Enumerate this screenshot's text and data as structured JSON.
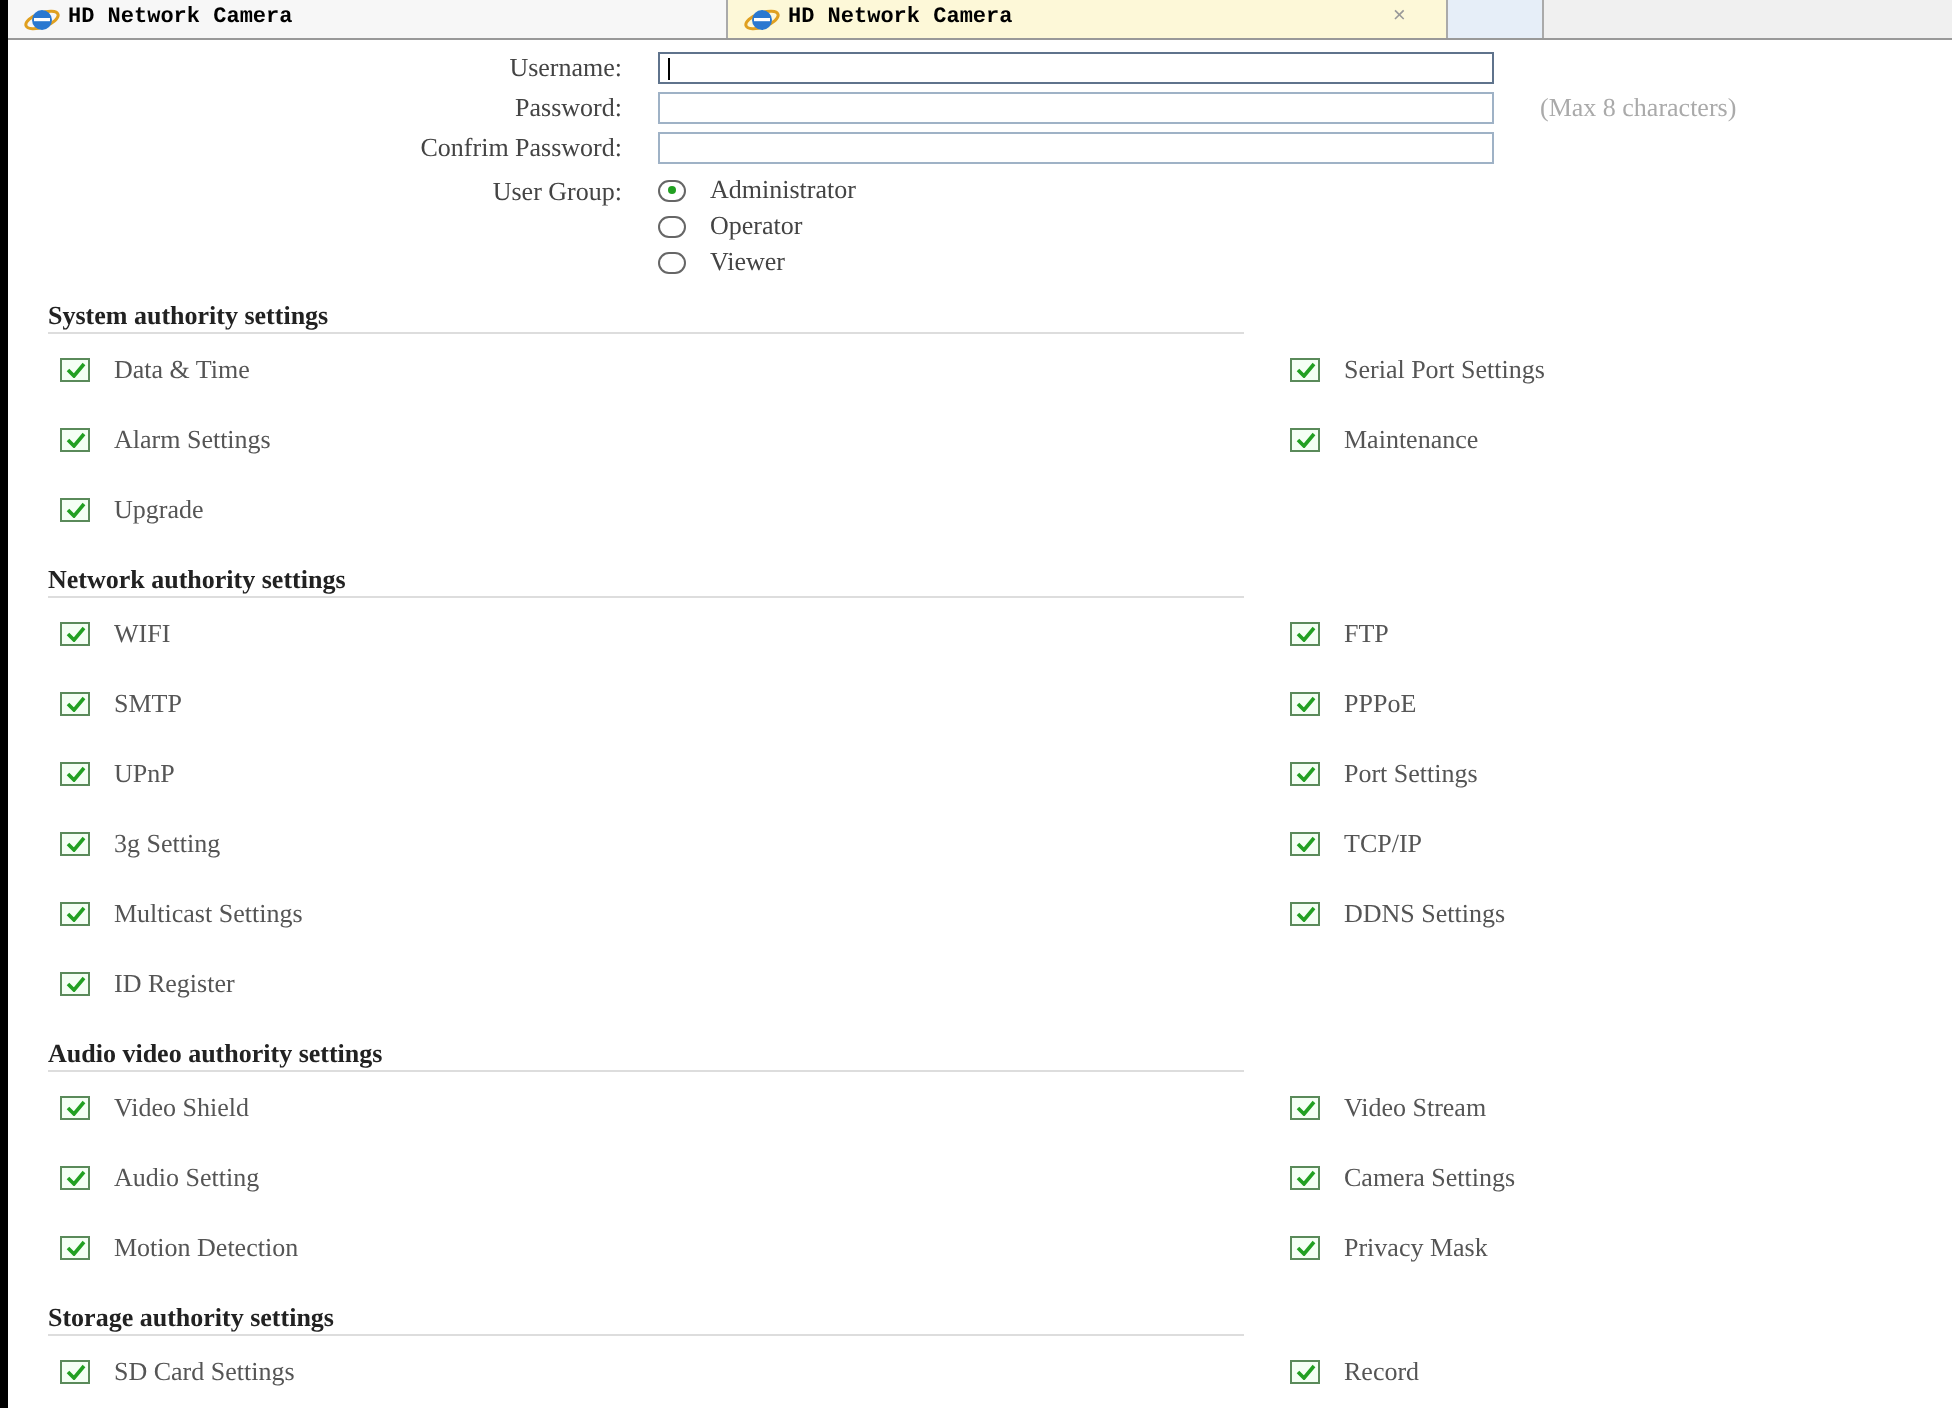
{
  "tabs": [
    {
      "label": "HD Network Camera",
      "selected": false
    },
    {
      "label": "HD Network Camera",
      "selected": true,
      "close": "×"
    }
  ],
  "form": {
    "fields": [
      {
        "label": "Username:",
        "focused": true
      },
      {
        "label": "Password:",
        "focused": false,
        "hint": "(Max 8 characters)"
      },
      {
        "label": "Confrim Password:",
        "focused": false
      }
    ],
    "user_group": {
      "label": "User Group:",
      "options": [
        {
          "label": "Administrator",
          "selected": true
        },
        {
          "label": "Operator",
          "selected": false
        },
        {
          "label": "Viewer",
          "selected": false
        }
      ]
    }
  },
  "sections": [
    {
      "title": "System authority settings",
      "items": [
        {
          "label": "Data & Time",
          "checked": true
        },
        {
          "label": "Serial Port Settings",
          "checked": true
        },
        {
          "label": "Alarm Settings",
          "checked": true
        },
        {
          "label": "Maintenance",
          "checked": true
        },
        {
          "label": "Upgrade",
          "checked": true
        }
      ]
    },
    {
      "title": "Network authority settings",
      "items": [
        {
          "label": "WIFI",
          "checked": true
        },
        {
          "label": "FTP",
          "checked": true
        },
        {
          "label": "SMTP",
          "checked": true
        },
        {
          "label": "PPPoE",
          "checked": true
        },
        {
          "label": "UPnP",
          "checked": true
        },
        {
          "label": "Port Settings",
          "checked": true
        },
        {
          "label": "3g Setting",
          "checked": true
        },
        {
          "label": "TCP/IP",
          "checked": true
        },
        {
          "label": "Multicast Settings",
          "checked": true
        },
        {
          "label": "DDNS Settings",
          "checked": true
        },
        {
          "label": "ID Register",
          "checked": true
        }
      ]
    },
    {
      "title": "Audio video authority settings",
      "items": [
        {
          "label": "Video Shield",
          "checked": true
        },
        {
          "label": "Video Stream",
          "checked": true
        },
        {
          "label": "Audio Setting",
          "checked": true
        },
        {
          "label": "Camera Settings",
          "checked": true
        },
        {
          "label": "Motion Detection",
          "checked": true
        },
        {
          "label": "Privacy Mask",
          "checked": true
        }
      ]
    },
    {
      "title": "Storage authority settings",
      "items": [
        {
          "label": "SD Card Settings",
          "checked": true
        },
        {
          "label": "Record",
          "checked": true
        }
      ]
    }
  ]
}
